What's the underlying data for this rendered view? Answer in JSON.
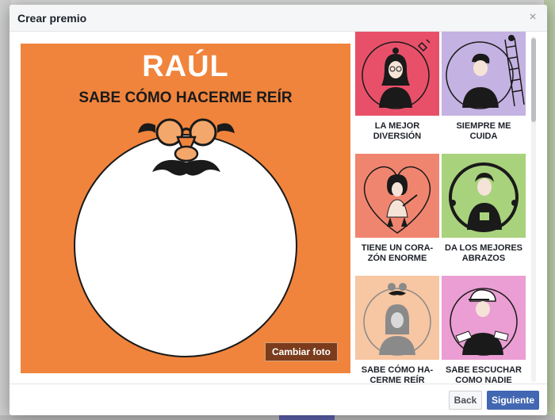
{
  "modal": {
    "title": "Crear premio",
    "close_glyph": "×"
  },
  "preview": {
    "name": "RAÚL",
    "caption": "SABE CÓMO HACERME REÍR",
    "change_photo_label": "Cambiar foto",
    "background_color": "#f0843c"
  },
  "awards": [
    {
      "label": "LA MEJOR DIVERSIÓN",
      "bg": "#e8506a"
    },
    {
      "label": "SIEMPRE ME CUIDA",
      "bg": "#c4b2e2"
    },
    {
      "label": "TIENE UN CORA-ZÓN ENORME",
      "bg": "#f0856f"
    },
    {
      "label": "DA LOS MEJORES ABRAZOS",
      "bg": "#a9d27d"
    },
    {
      "label": "SABE CÓMO HA-CERME REÍR",
      "bg": "#f7c6a2"
    },
    {
      "label": "SABE ESCUCHAR COMO NADIE",
      "bg": "#ea9ed3"
    }
  ],
  "footer": {
    "back_label": "Back",
    "next_label": "Siguiente"
  },
  "colors": {
    "primary": "#4267b2",
    "brown_button": "#7a3c1c"
  }
}
